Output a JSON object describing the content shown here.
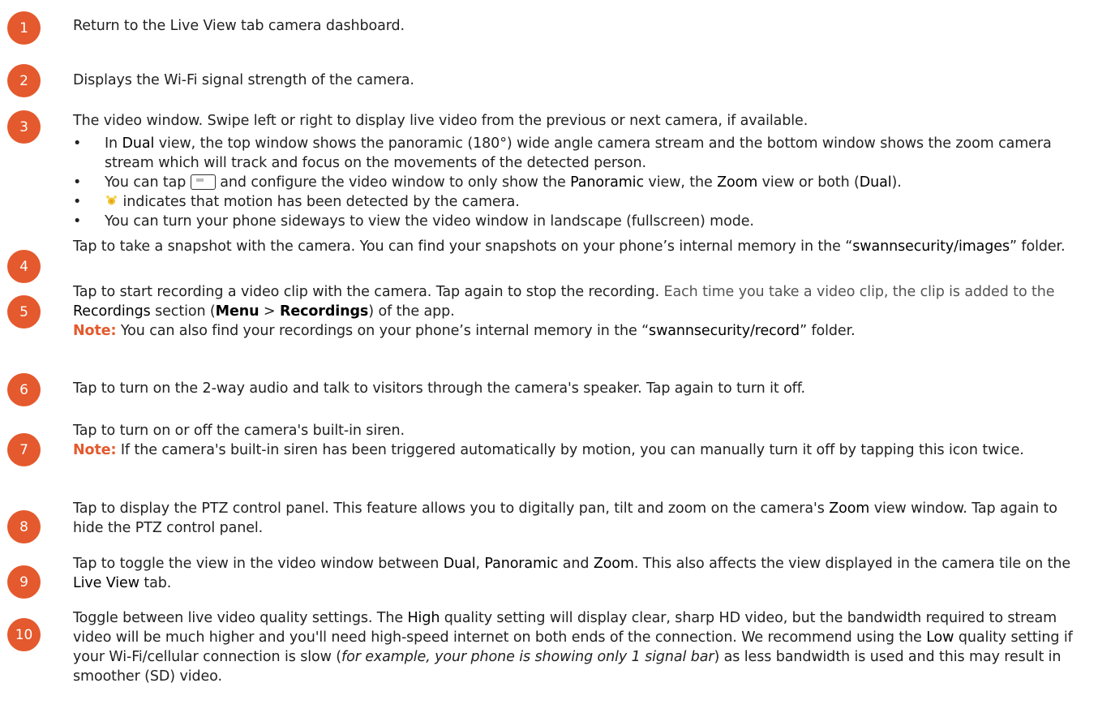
{
  "items": [
    {
      "num": "1",
      "text": "Return to the Live View tab camera dashboard."
    },
    {
      "num": "2",
      "text": "Displays the Wi-Fi signal strength of the camera."
    },
    {
      "num": "3",
      "text": "The video window. Swipe left or right to display live video from the previous or next camera, if available.",
      "bullets": {
        "b1": {
          "pre": "In ",
          "kw": "Dual",
          "post": " view, the top window shows the panoramic (180°) wide angle camera stream and the bottom window shows the zoom camera stream which will track and focus on the movements of the detected person."
        },
        "b2": {
          "pre": "You can tap ",
          "mid": " and configure the video window to only show the ",
          "kw1": "Panoramic",
          "mid2": " view, the ",
          "kw2": "Zoom",
          "mid3": " view or both (",
          "kw3": "Dual",
          "post": ")."
        },
        "b3": {
          "post": " indicates that motion has been detected by the camera."
        },
        "b4": {
          "text": "You can turn your phone sideways to view the video window in landscape (fullscreen) mode."
        }
      }
    },
    {
      "num": "4",
      "pre": "Tap to take a snapshot with the camera. You can find your snapshots on your phone’s internal memory in the “",
      "kw": "swannsecurity/images",
      "post": "” folder."
    },
    {
      "num": "5",
      "pre": "Tap to start recording a video clip with the camera. Tap again to stop the recording. ",
      "grey": "Each time you take a video clip, the clip is added to the ",
      "kw": "Recordings",
      "mid": " section (",
      "b1": "Menu",
      "gt": " > ",
      "b2": "Recordings",
      "post": ") of the app.",
      "note_label": "Note:",
      "note_pre": " You can also find your recordings on your phone’s internal memory in the “",
      "note_kw": "swannsecurity/record",
      "note_post": "” folder."
    },
    {
      "num": "6",
      "text": "Tap to turn on the 2-way audio and talk to visitors through the camera's speaker. Tap again to turn it off."
    },
    {
      "num": "7",
      "text": "Tap to turn on or off the camera's built-in siren.",
      "note_label": "Note:",
      "note_text": " If the camera's built-in siren has been triggered automatically by motion, you can manually turn it off by tapping this icon twice."
    },
    {
      "num": "8",
      "pre": "Tap to display the PTZ control panel. This feature allows you to digitally pan, tilt and zoom on the camera's ",
      "kw": "Zoom",
      "post": " view window. Tap again to hide the PTZ control panel."
    },
    {
      "num": "9",
      "pre": "Tap to toggle the view in the video window between ",
      "kw1": "Dual",
      "m1": ", ",
      "kw2": "Panoramic",
      "m2": " and ",
      "kw3": "Zoom",
      "m3": ". This also affects the view displayed in the camera tile on the ",
      "kw4": "Live View",
      "post": " tab."
    },
    {
      "num": "10",
      "pre": "Toggle between live video quality settings. The ",
      "kw1": "High",
      "m1": " quality setting will display clear, sharp HD video, but the bandwidth required to stream video will be much higher and you'll need high-speed internet on both ends of the connection. We recommend using the ",
      "kw2": "Low",
      "m2": " quality setting if your Wi-Fi/cellular connection is slow (",
      "ital": "for example, your phone is showing only 1 signal bar",
      "post": ") as less bandwidth is used and this may result in smoother (SD) video."
    }
  ],
  "icons": {
    "window": "video-window-icon",
    "motion": "motion-detected-icon"
  },
  "colors": {
    "accent": "#e4592d"
  }
}
